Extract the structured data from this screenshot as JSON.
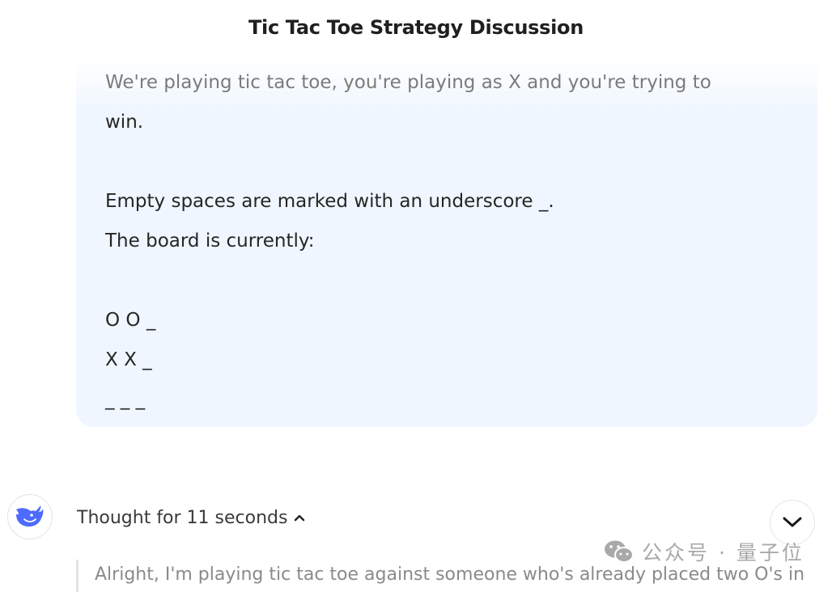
{
  "header": {
    "title": "Tic Tac Toe Strategy Discussion"
  },
  "user_message": {
    "lines": [
      "We're playing tic tac toe, you're playing as X and you're trying to",
      "win.",
      "",
      "Empty spaces are marked with an underscore _.",
      "The board is currently:",
      "",
      "O O _",
      "X X _",
      "_ _ _"
    ]
  },
  "assistant": {
    "avatar_icon": "whale-logo-icon",
    "thought_label": "Thought for 11 seconds",
    "thought_toggle_icon": "chevron-up-icon",
    "thinking_preview": "Alright, I'm playing tic tac toe against someone who's already placed two O's in"
  },
  "controls": {
    "scroll_down_icon": "chevron-down-icon"
  },
  "watermark": {
    "icon": "wechat-icon",
    "text": "公众号 · 量子位"
  },
  "colors": {
    "bubble_bg": "#eff6ff",
    "logo_blue": "#4d6bfe",
    "watermark": "#a9a9a9"
  }
}
